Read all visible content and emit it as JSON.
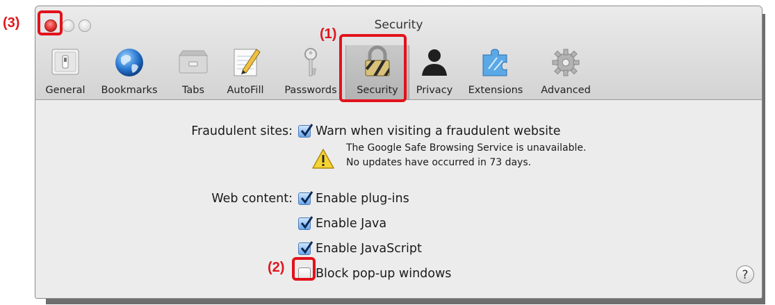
{
  "window": {
    "title": "Security"
  },
  "toolbar": {
    "items": [
      {
        "label": "General",
        "icon": "general-switch-icon"
      },
      {
        "label": "Bookmarks",
        "icon": "globe-icon"
      },
      {
        "label": "Tabs",
        "icon": "tabs-icon"
      },
      {
        "label": "AutoFill",
        "icon": "autofill-pencil-icon"
      },
      {
        "label": "Passwords",
        "icon": "key-icon"
      },
      {
        "label": "Security",
        "icon": "padlock-icon",
        "selected": true
      },
      {
        "label": "Privacy",
        "icon": "person-silhouette-icon"
      },
      {
        "label": "Extensions",
        "icon": "puzzle-icon"
      },
      {
        "label": "Advanced",
        "icon": "gear-icon"
      }
    ]
  },
  "security": {
    "fraudulent_label": "Fraudulent sites:",
    "warn_label": "Warn when visiting a fraudulent website",
    "warn_checked": true,
    "warning_line1": "The Google Safe Browsing Service is unavailable.",
    "warning_line2": "No updates have occurred in 73 days.",
    "web_content_label": "Web content:",
    "plugins_label": "Enable plug-ins",
    "plugins_checked": true,
    "java_label": "Enable Java",
    "java_checked": true,
    "javascript_label": "Enable JavaScript",
    "javascript_checked": true,
    "popup_label": "Block pop-up windows",
    "popup_checked": false,
    "help_glyph": "?"
  },
  "annotations": {
    "step1": "(1)",
    "step2": "(2)",
    "step3": "(3)",
    "color": "#e0151c"
  }
}
